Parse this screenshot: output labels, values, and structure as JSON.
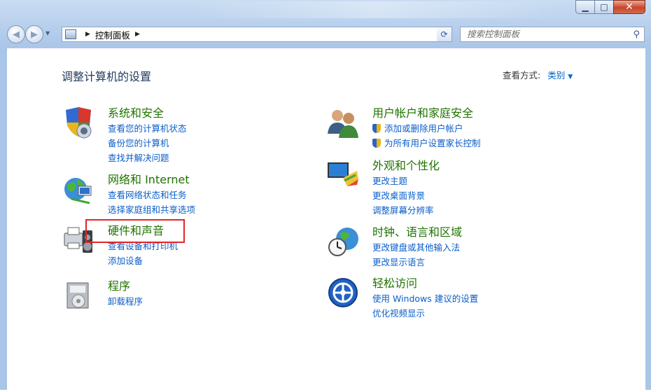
{
  "window": {
    "controls": {
      "minimize": "▁",
      "maximize": "□",
      "close": "✕"
    }
  },
  "address": {
    "breadcrumb": "控制面板",
    "search_placeholder": "搜索控制面板"
  },
  "header": {
    "title": "调整计算机的设置",
    "view_label": "查看方式:",
    "view_value": "类别"
  },
  "categories_left": [
    {
      "title": "系统和安全",
      "links": [
        "查看您的计算机状态",
        "备份您的计算机",
        "查找并解决问题"
      ]
    },
    {
      "title": "网络和 Internet",
      "links": [
        "查看网络状态和任务",
        "选择家庭组和共享选项"
      ]
    },
    {
      "title": "硬件和声音",
      "links": [
        "查看设备和打印机",
        "添加设备"
      ]
    },
    {
      "title": "程序",
      "links": [
        "卸载程序"
      ]
    }
  ],
  "categories_right": [
    {
      "title": "用户帐户和家庭安全",
      "links": [
        "添加或删除用户帐户",
        "为所有用户设置家长控制"
      ]
    },
    {
      "title": "外观和个性化",
      "links": [
        "更改主题",
        "更改桌面背景",
        "调整屏幕分辨率"
      ]
    },
    {
      "title": "时钟、语言和区域",
      "links": [
        "更改键盘或其他输入法",
        "更改显示语言"
      ]
    },
    {
      "title": "轻松访问",
      "links": [
        "使用 Windows 建议的设置",
        "优化视频显示"
      ]
    }
  ],
  "colors": {
    "category_title": "#1f7300",
    "link": "#0b5ec9",
    "highlight": "#e0252a"
  }
}
